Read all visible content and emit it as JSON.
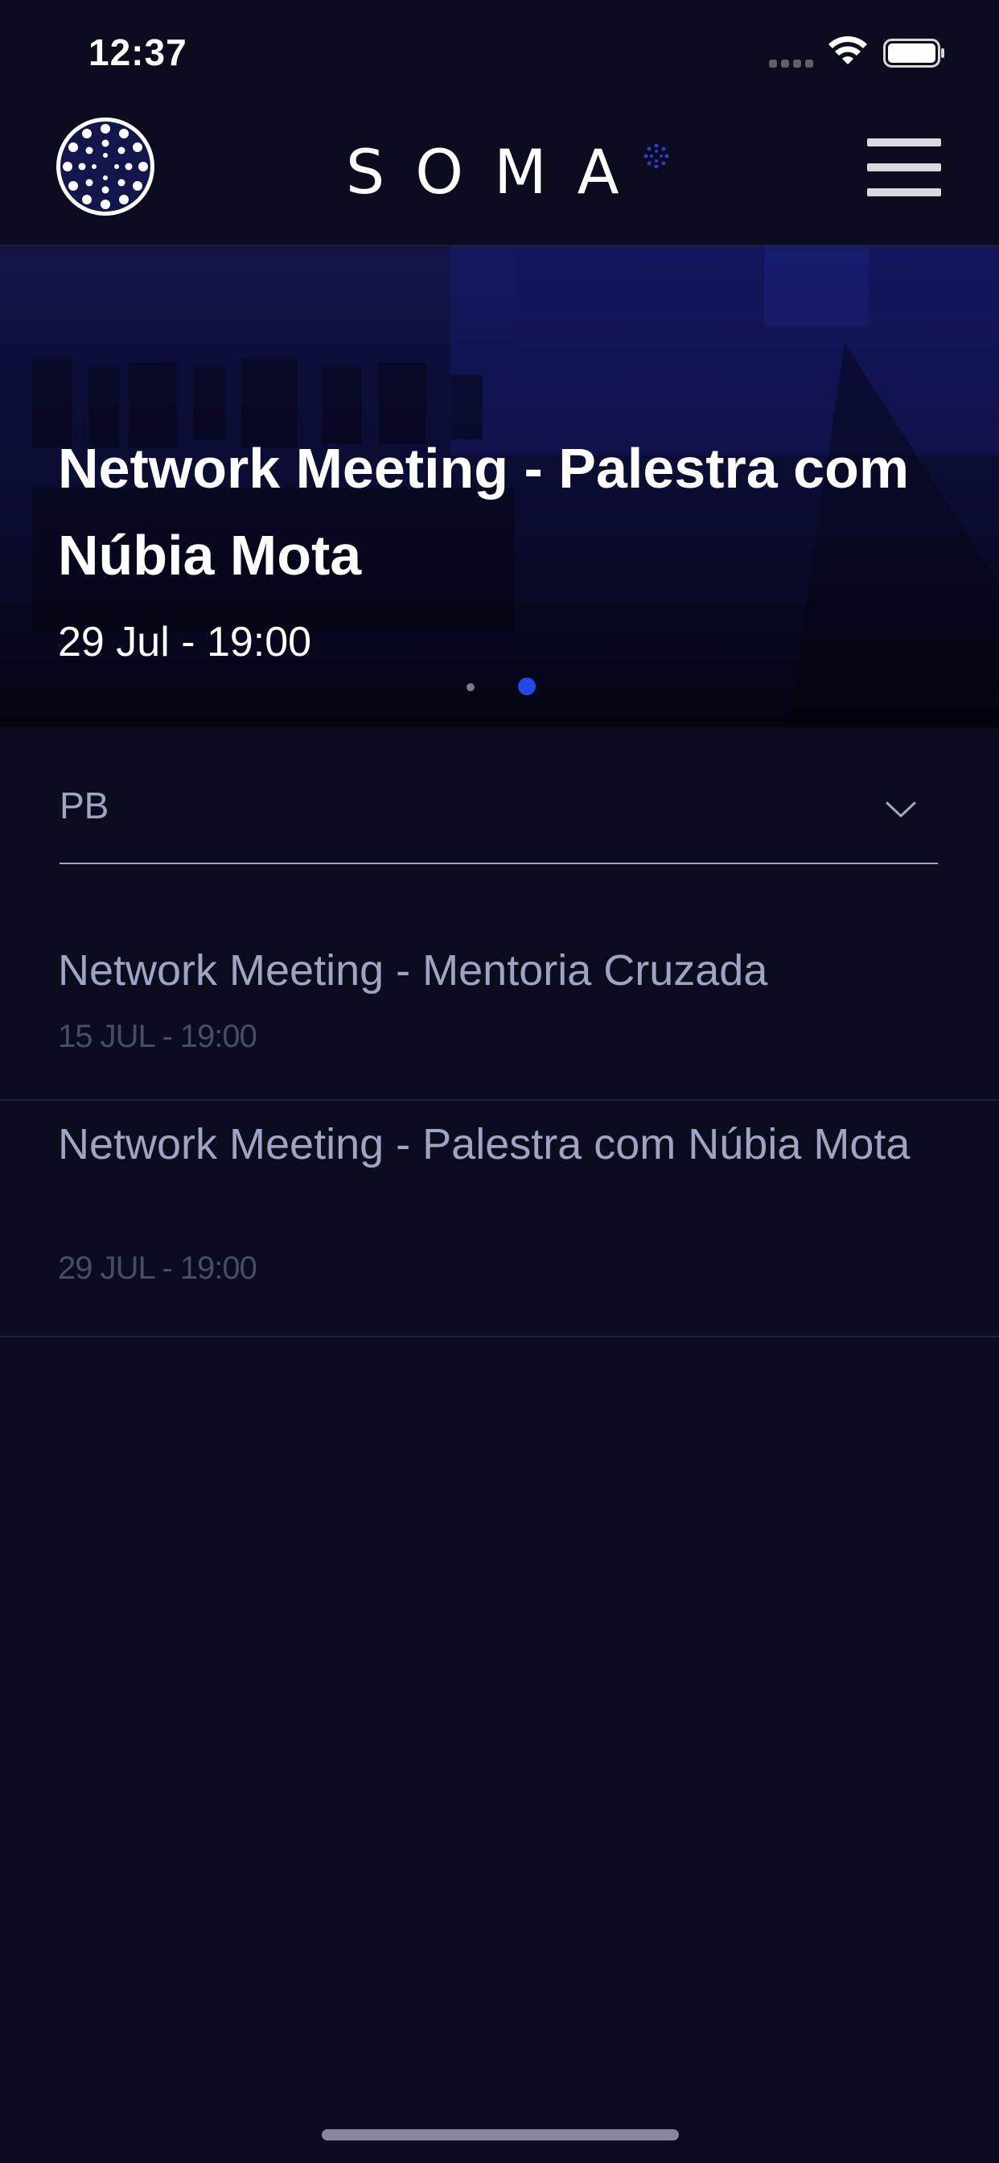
{
  "status_bar": {
    "time": "12:37"
  },
  "header": {
    "brand": "SOMA",
    "avatar_icon": "dotted-circle-logo-icon",
    "menu_icon": "hamburger-menu-icon",
    "brand_accent_color": "#2a3cd6"
  },
  "hero": {
    "title": "Network Meeting - Palestra com Núbia Mota",
    "date": "29 Jul - 19:00",
    "slide_count": 2,
    "active_slide": 2,
    "active_dot_color": "#2448e8"
  },
  "filter": {
    "value": "PB",
    "icon": "chevron-down-icon"
  },
  "events": [
    {
      "title": "Network Meeting - Mentoria Cruzada",
      "date": "15 JUL - 19:00"
    },
    {
      "title": "Network Meeting - Palestra com Núbia Mota",
      "date": "29 JUL - 19:00"
    }
  ],
  "colors": {
    "background": "#0b0d1e",
    "text_primary": "#ffffff",
    "text_muted": "#a1a3c1",
    "text_date": "#4a4c62"
  }
}
